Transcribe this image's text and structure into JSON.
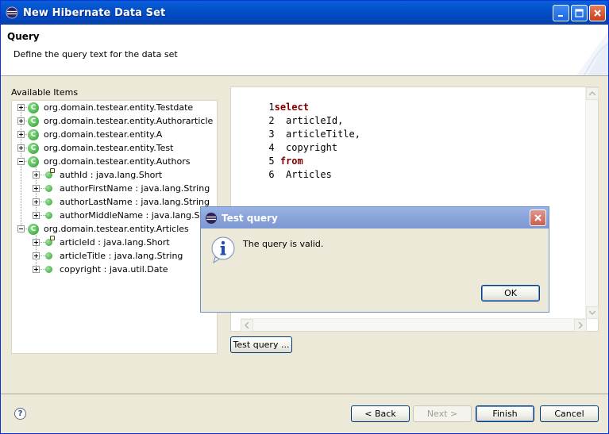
{
  "window": {
    "title": "New Hibernate Data Set",
    "accent": "#0250c9"
  },
  "header": {
    "title": "Query",
    "description": "Define the query text for the data set"
  },
  "available": {
    "label": "Available Items",
    "items": [
      {
        "type": "class",
        "toggle": "plus",
        "label": "org.domain.testear.entity.Testdate"
      },
      {
        "type": "class",
        "toggle": "plus",
        "label": "org.domain.testear.entity.Authorarticle"
      },
      {
        "type": "class",
        "toggle": "plus",
        "label": "org.domain.testear.entity.A"
      },
      {
        "type": "class",
        "toggle": "plus",
        "label": "org.domain.testear.entity.Test"
      },
      {
        "type": "class",
        "toggle": "minus",
        "label": "org.domain.testear.entity.Authors"
      },
      {
        "type": "field",
        "key": true,
        "label": "authId : java.lang.Short"
      },
      {
        "type": "field",
        "key": false,
        "label": "authorFirstName : java.lang.String"
      },
      {
        "type": "field",
        "key": false,
        "label": "authorLastName : java.lang.String"
      },
      {
        "type": "field",
        "key": false,
        "label": "authorMiddleName : java.lang.String"
      },
      {
        "type": "class",
        "toggle": "minus",
        "label": "org.domain.testear.entity.Articles"
      },
      {
        "type": "field",
        "key": true,
        "label": "articleId : java.lang.Short"
      },
      {
        "type": "field",
        "key": false,
        "label": "articleTitle : java.lang.String"
      },
      {
        "type": "field",
        "key": false,
        "label": "copyright : java.util.Date"
      }
    ]
  },
  "editor": {
    "lines": [
      {
        "num": "1",
        "text": "select",
        "keyword": true
      },
      {
        "num": "2",
        "text": "  articleId,",
        "keyword": false
      },
      {
        "num": "3",
        "text": "  articleTitle,",
        "keyword": false
      },
      {
        "num": "4",
        "text": "  copyright",
        "keyword": false
      },
      {
        "num": "5",
        "text": " from",
        "keyword": true
      },
      {
        "num": "6",
        "text": "  Articles",
        "keyword": false
      }
    ],
    "keyword_color": "#7f0000"
  },
  "test_query_button": "Test query ...",
  "footer": {
    "help_icon": "help-icon",
    "back": "< Back",
    "next": "Next >",
    "finish": "Finish",
    "cancel": "Cancel"
  },
  "dialog": {
    "title": "Test query",
    "message": "The query is valid.",
    "ok": "OK",
    "icon": "info-icon"
  }
}
